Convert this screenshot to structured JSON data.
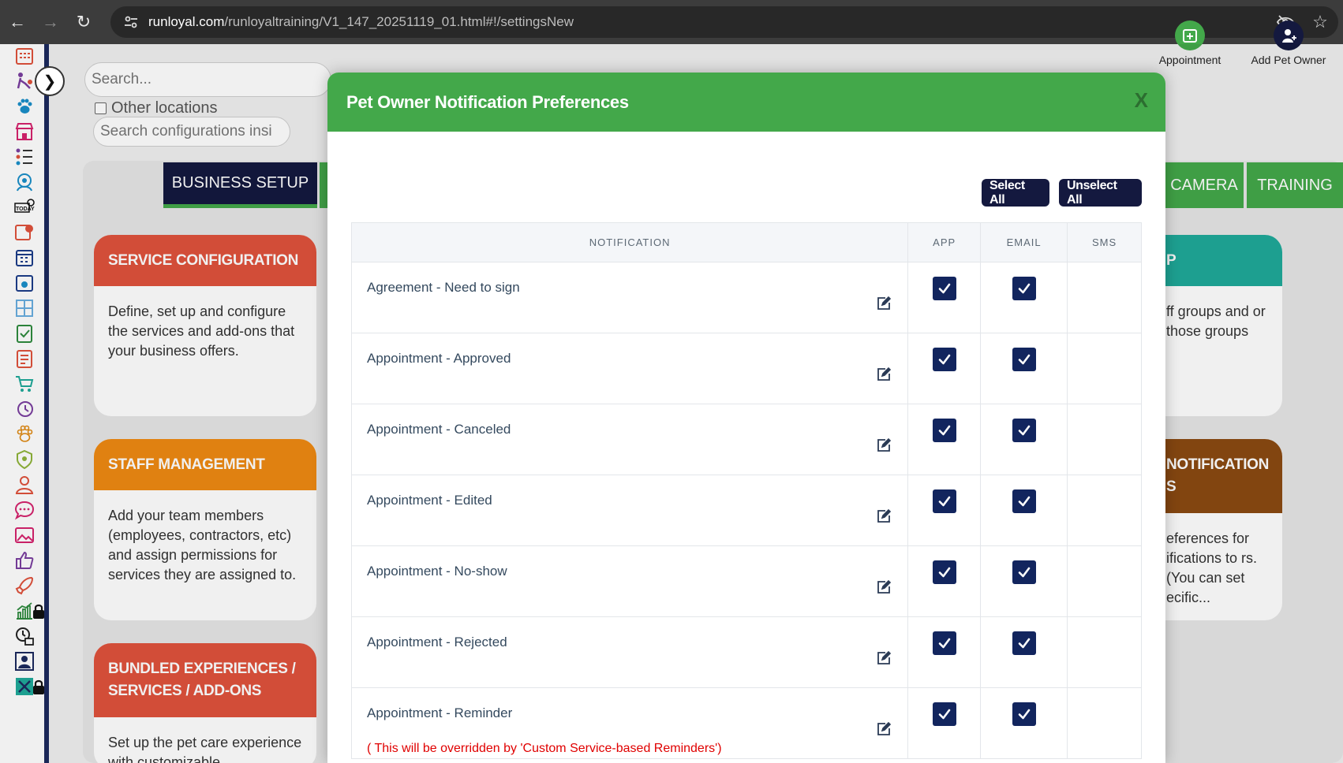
{
  "browser": {
    "url_host": "runloyal.com",
    "url_path": "/runloyaltraining/V1_147_20251119_01.html#!/settingsNew"
  },
  "background": {
    "search_placeholder": "Search...",
    "other_locations_label": "Other locations",
    "config_search_placeholder": "Search configurations insi",
    "header_actions": [
      {
        "label": "Appointment",
        "icon": "calendar-plus-icon",
        "color": "#43a84a"
      },
      {
        "label": "Add Pet Owner",
        "icon": "user-add-icon",
        "color": "#14193f"
      }
    ],
    "tabs": [
      {
        "label": "BUSINESS SETUP",
        "bg": "#14193f"
      },
      {
        "label": "CAMERA",
        "bg": "#43a84a"
      },
      {
        "label": "TRAINING",
        "bg": "#43a84a"
      }
    ],
    "cards": [
      {
        "title": "SERVICE CONFIGURATION",
        "color": "#e0523c",
        "body": "Define, set up and configure the services and add-ons that your business offers."
      },
      {
        "title": "STAFF MANAGEMENT",
        "color": "#ef8a13",
        "body": "Add your team members (employees, contractors, etc) and assign permissions for services they are assigned to."
      },
      {
        "title": "BUNDLED EXPERIENCES / SERVICES / ADD-ONS",
        "color": "#e0523c",
        "body": "Set up the pet care experience with customizable"
      },
      {
        "title": "P",
        "color": "#1fa99a",
        "body": "ff groups and or those groups"
      },
      {
        "title": "NOTIFICATION S",
        "color": "#8b4a12",
        "body": "eferences for ifications to rs. (You can set ecific..."
      }
    ]
  },
  "modal": {
    "title": "Pet Owner Notification Preferences",
    "close_label": "X",
    "select_all_label": "Select All",
    "unselect_all_label": "Unselect All",
    "columns": [
      "NOTIFICATION",
      "APP",
      "EMAIL",
      "SMS"
    ],
    "rows": [
      {
        "label": "Agreement - Need to sign",
        "app": true,
        "email": true,
        "sms": false,
        "note": ""
      },
      {
        "label": "Appointment - Approved",
        "app": true,
        "email": true,
        "sms": false,
        "note": ""
      },
      {
        "label": "Appointment - Canceled",
        "app": true,
        "email": true,
        "sms": false,
        "note": ""
      },
      {
        "label": "Appointment - Edited",
        "app": true,
        "email": true,
        "sms": false,
        "note": ""
      },
      {
        "label": "Appointment - No-show",
        "app": true,
        "email": true,
        "sms": false,
        "note": ""
      },
      {
        "label": "Appointment - Rejected",
        "app": true,
        "email": true,
        "sms": false,
        "note": ""
      },
      {
        "label": "Appointment - Reminder",
        "app": true,
        "email": true,
        "sms": false,
        "note": "( This will be overridden by 'Custom Service-based Reminders')"
      }
    ]
  }
}
